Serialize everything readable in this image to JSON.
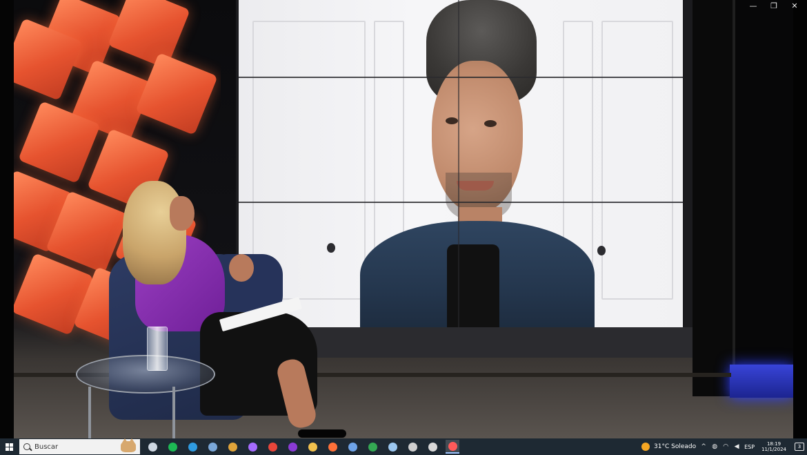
{
  "window_controls": {
    "minimize": "—",
    "restore": "❐",
    "close": "✕"
  },
  "taskbar": {
    "search_placeholder": "Buscar",
    "apps": [
      {
        "name": "task-view-icon",
        "color": "#cfd8e3"
      },
      {
        "name": "spotify-icon",
        "color": "#1db954"
      },
      {
        "name": "edge-icon",
        "color": "#2f9be0"
      },
      {
        "name": "store-icon",
        "color": "#7aa7d8"
      },
      {
        "name": "gem-icon",
        "color": "#e0a43a"
      },
      {
        "name": "meta-icon",
        "color": "#a66cff"
      },
      {
        "name": "chrome-icon",
        "color": "#e8463a"
      },
      {
        "name": "opera-icon",
        "color": "#8a3bd6"
      },
      {
        "name": "file-explorer-icon",
        "color": "#f2c14e"
      },
      {
        "name": "firefox-icon",
        "color": "#ff7139"
      },
      {
        "name": "vpn-icon",
        "color": "#6fa4e8"
      },
      {
        "name": "chrome-alt-icon",
        "color": "#34a853"
      },
      {
        "name": "notepad-icon",
        "color": "#9bc7f0"
      },
      {
        "name": "people-icon",
        "color": "#cfcfcf"
      },
      {
        "name": "bird-icon",
        "color": "#d9d9d9"
      },
      {
        "name": "media-player-icon",
        "color": "#ff5a5a",
        "active": true
      }
    ],
    "weather": "31°C  Soleado",
    "language": "ESP",
    "time": "18:19",
    "date": "11/1/2024",
    "notifications": "3"
  }
}
